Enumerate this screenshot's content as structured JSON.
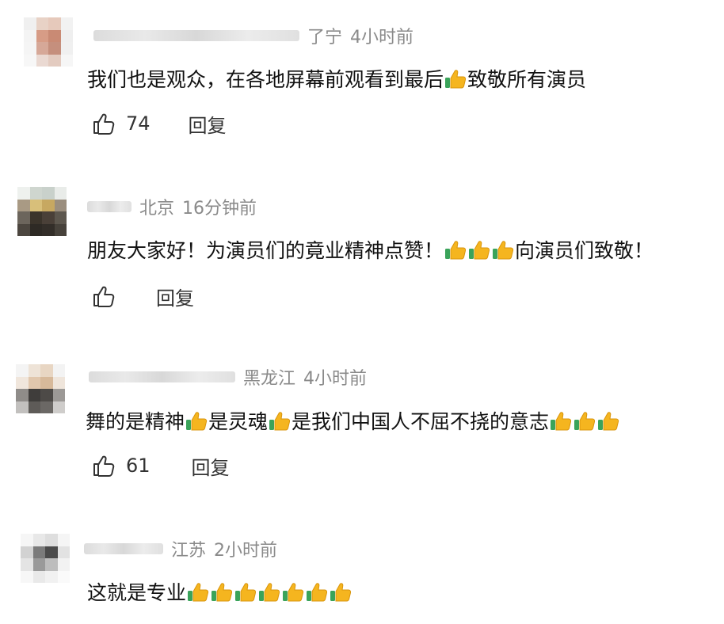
{
  "comments": [
    {
      "location": "了宁",
      "time": "4小时前",
      "text_parts": [
        "我们也是观众，在各地屏幕前观看到最后",
        "致敬所有演员"
      ],
      "like_count": "74",
      "reply_label": "回复"
    },
    {
      "location": "北京",
      "time": "16分钟前",
      "text_parts": [
        "朋友大家好！为演员们的竟业精神点赞！",
        "向演员们致敬！"
      ],
      "like_count": "",
      "reply_label": "回复"
    },
    {
      "location": "黑龙江",
      "time": "4小时前",
      "text_parts": [
        "舞的是精神",
        "是灵魂",
        "是我们中国人不屈不挠的意志"
      ],
      "like_count": "61",
      "reply_label": "回复"
    },
    {
      "location": "江苏",
      "time": "2小时前",
      "text_parts": [
        "这就是专业"
      ],
      "like_count": "",
      "reply_label": ""
    }
  ],
  "icons": {
    "emoji": "thumbs-up-emoji",
    "like": "thumbs-up-outline-icon"
  },
  "colors": {
    "meta": "#8a8a8a",
    "text": "#111111",
    "emoji": "#f5b51f",
    "emoji_cuff": "#3aa35a"
  }
}
